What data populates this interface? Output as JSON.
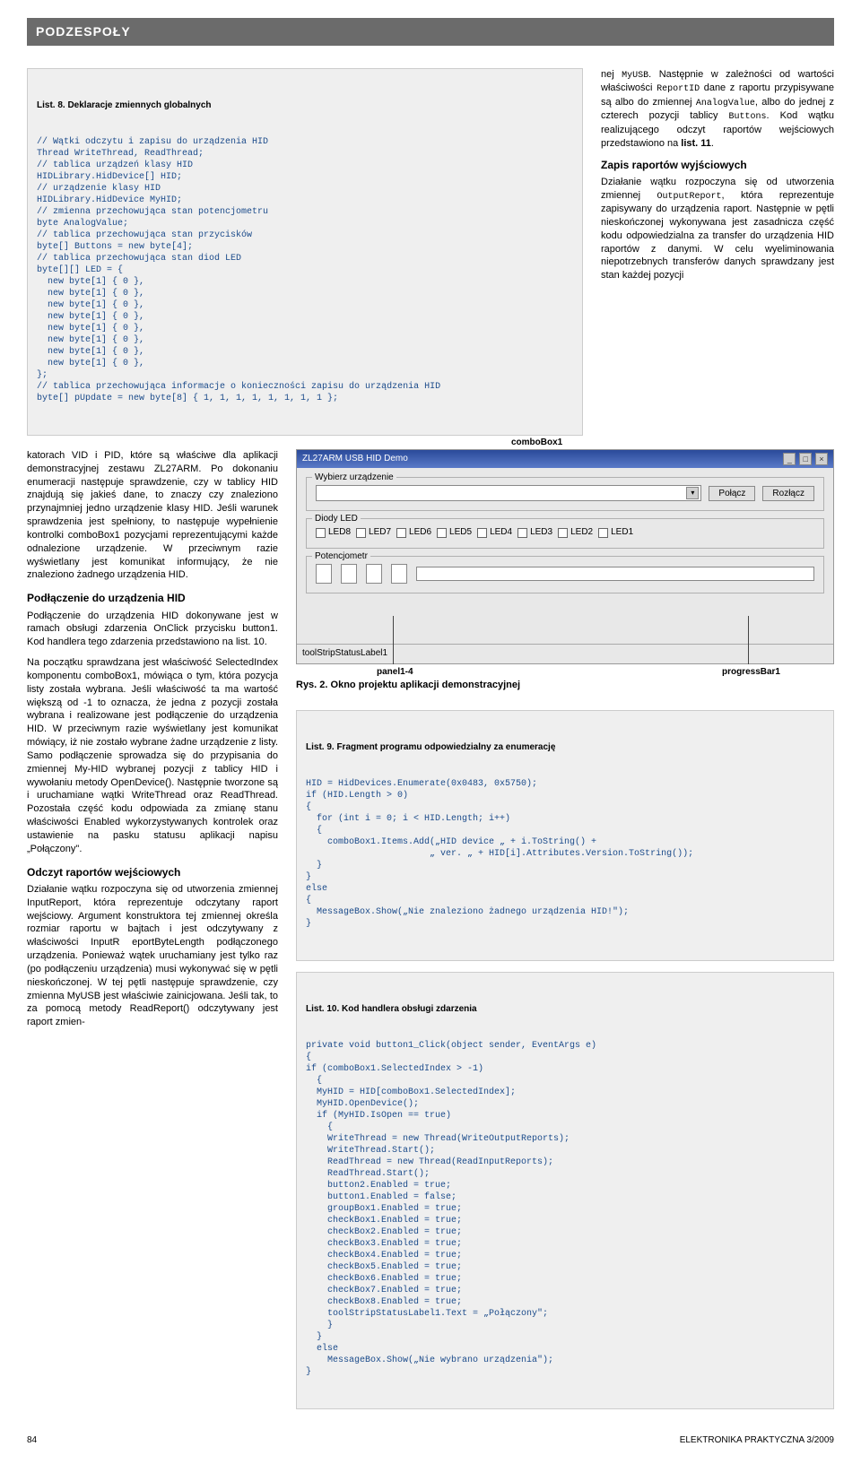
{
  "header": {
    "section": "PODZESPOŁY"
  },
  "listing8": {
    "title": "List. 8. Deklaracje zmiennych globalnych",
    "code": "// Wątki odczytu i zapisu do urządzenia HID\nThread WriteThread, ReadThread;\n// tablica urządzeń klasy HID\nHIDLibrary.HidDevice[] HID;\n// urządzenie klasy HID\nHIDLibrary.HidDevice MyHID;\n// zmienna przechowująca stan potencjometru\nbyte AnalogValue;\n// tablica przechowująca stan przycisków\nbyte[] Buttons = new byte[4];\n// tablica przechowująca stan diod LED\nbyte[][] LED = {\n  new byte[1] { 0 },\n  new byte[1] { 0 },\n  new byte[1] { 0 },\n  new byte[1] { 0 },\n  new byte[1] { 0 },\n  new byte[1] { 0 },\n  new byte[1] { 0 },\n  new byte[1] { 0 },\n};\n// tablica przechowująca informacje o konieczności zapisu do urządzenia HID\nbyte[] pUpdate = new byte[8] { 1, 1, 1, 1, 1, 1, 1, 1 };"
  },
  "side": {
    "p1a": "nej ",
    "p1b": "MyUSB",
    "p1c": ". Następnie w zależności od wartości właściwości ",
    "p1d": "ReportID",
    "p1e": " dane z raportu przypisywane są albo do zmiennej ",
    "p1f": "AnalogValue",
    "p1g": ", albo do jednej z czterech pozycji tablicy ",
    "p1h": "Buttons",
    "p1i": ". Kod wątku realizującego odczyt raportów wejściowych przedstawiono na ",
    "p1j": "list. 11",
    "p1k": ".",
    "sub": "Zapis raportów wyjściowych",
    "p2a": "Działanie wątku rozpoczyna się od utworzenia zmiennej ",
    "p2b": "OutputReport",
    "p2c": ", która reprezentuje zapisywany do urządzenia raport. Następnie w pętli nieskończonej wykonywana jest zasadnicza część kodu odpowiedzialna za transfer do urządzenia HID raportów z danymi.  W celu wyeliminowania niepotrzebnych transferów danych sprawdzany jest stan każdej pozycji"
  },
  "left": {
    "p1": "katorach VID i PID, które są właściwe dla aplikacji demonstracyjnej zestawu ZL27ARM. Po dokonaniu enumeracji następuje sprawdzenie, czy w tablicy HID znajdują się jakieś dane, to znaczy czy znaleziono przynajmniej jedno urządzenie klasy HID. Jeśli warunek sprawdzenia jest spełniony, to następuje wypełnienie kontrolki comboBox1 pozycjami reprezentującymi każde odnalezione urządzenie. W przeciwnym razie wyświetlany jest komunikat informujący, że nie znaleziono żadnego urządzenia HID.",
    "sub1": "Podłączenie do urządzenia HID",
    "p2": "Podłączenie do urządzenia HID dokonywane jest w ramach obsługi zdarzenia OnClick przycisku button1. Kod handlera tego zdarzenia przedstawiono na list. 10.",
    "p3": "Na początku sprawdzana jest właściwość SelectedIndex komponentu comboBox1, mówiąca o tym, która pozycja listy została wybrana. Jeśli właściwość ta ma wartość większą od -1 to oznacza, że jedna z pozycji została wybrana i realizowane jest podłączenie do urządzenia HID. W przeciwnym razie wyświetlany jest komunikat mówiący, iż nie zostało wybrane żadne urządzenie z listy. Samo podłączenie sprowadza się do przypisania do zmiennej My-HID wybranej pozycji z tablicy HID i wywołaniu metody OpenDevice(). Następnie tworzone są i uruchamiane wątki WriteThread oraz ReadThread. Pozostała część kodu odpowiada za zmianę stanu właściwości Enabled wykorzystywanych kontrolek oraz ustawienie na pasku statusu aplikacji napisu „Połączony\".",
    "sub2": "Odczyt raportów wejściowych",
    "p4": "Działanie wątku rozpoczyna się od utworzenia zmiennej InputReport, która reprezentuje odczytany raport wejściowy. Argument konstruktora tej zmiennej określa rozmiar raportu w bajtach i jest odczytywany z właściwości InputR eportByteLength podłączonego urządzenia. Ponieważ wątek uruchamiany jest tylko raz (po podłączeniu urządzenia) musi wykonywać się w pętli nieskończonej. W tej pętli następuje sprawdzenie, czy zmienna MyUSB jest właściwie zainicjowana. Jeśli tak, to za pomocą metody ReadReport() odczytywany jest raport zmien-"
  },
  "app": {
    "title": "ZL27ARM USB HID Demo",
    "combo_label": "Wybierz urządzenie",
    "btn_connect": "Połącz",
    "btn_disconnect": "Rozłącz",
    "group_leds": "Diody LED",
    "leds": [
      "LED8",
      "LED7",
      "LED6",
      "LED5",
      "LED4",
      "LED3",
      "LED2",
      "LED1"
    ],
    "group_pot": "Potencjometr",
    "status": "toolStripStatusLabel1",
    "callout_combo": "comboBox1",
    "callout_panel": "panel1-4",
    "callout_prog": "progressBar1"
  },
  "fig2": {
    "caption": "Rys. 2. Okno projektu aplikacji demonstracyjnej"
  },
  "listing9": {
    "title": "List. 9. Fragment programu odpowiedzialny za enumerację",
    "code": "HID = HidDevices.Enumerate(0x0483, 0x5750);\nif (HID.Length > 0)\n{\n  for (int i = 0; i < HID.Length; i++)\n  {\n    comboBox1.Items.Add(„HID device „ + i.ToString() +\n                       „ ver. „ + HID[i].Attributes.Version.ToString());\n  }\n}\nelse\n{\n  MessageBox.Show(„Nie znaleziono żadnego urządzenia HID!\");\n}"
  },
  "listing10": {
    "title": "List. 10. Kod handlera obsługi zdarzenia",
    "code": "private void button1_Click(object sender, EventArgs e)\n{\nif (comboBox1.SelectedIndex > -1)\n  {\n  MyHID = HID[comboBox1.SelectedIndex];\n  MyHID.OpenDevice();\n  if (MyHID.IsOpen == true)\n    {\n    WriteThread = new Thread(WriteOutputReports);\n    WriteThread.Start();\n    ReadThread = new Thread(ReadInputReports);\n    ReadThread.Start();\n    button2.Enabled = true;\n    button1.Enabled = false;\n    groupBox1.Enabled = true;\n    checkBox1.Enabled = true;\n    checkBox2.Enabled = true;\n    checkBox3.Enabled = true;\n    checkBox4.Enabled = true;\n    checkBox5.Enabled = true;\n    checkBox6.Enabled = true;\n    checkBox7.Enabled = true;\n    checkBox8.Enabled = true;\n    toolStripStatusLabel1.Text = „Połączony\";\n    }\n  }\n  else\n    MessageBox.Show(„Nie wybrano urządzenia\");\n}"
  },
  "footer": {
    "page": "84",
    "pub": "ELEKTRONIKA PRAKTYCZNA 3/2009"
  }
}
